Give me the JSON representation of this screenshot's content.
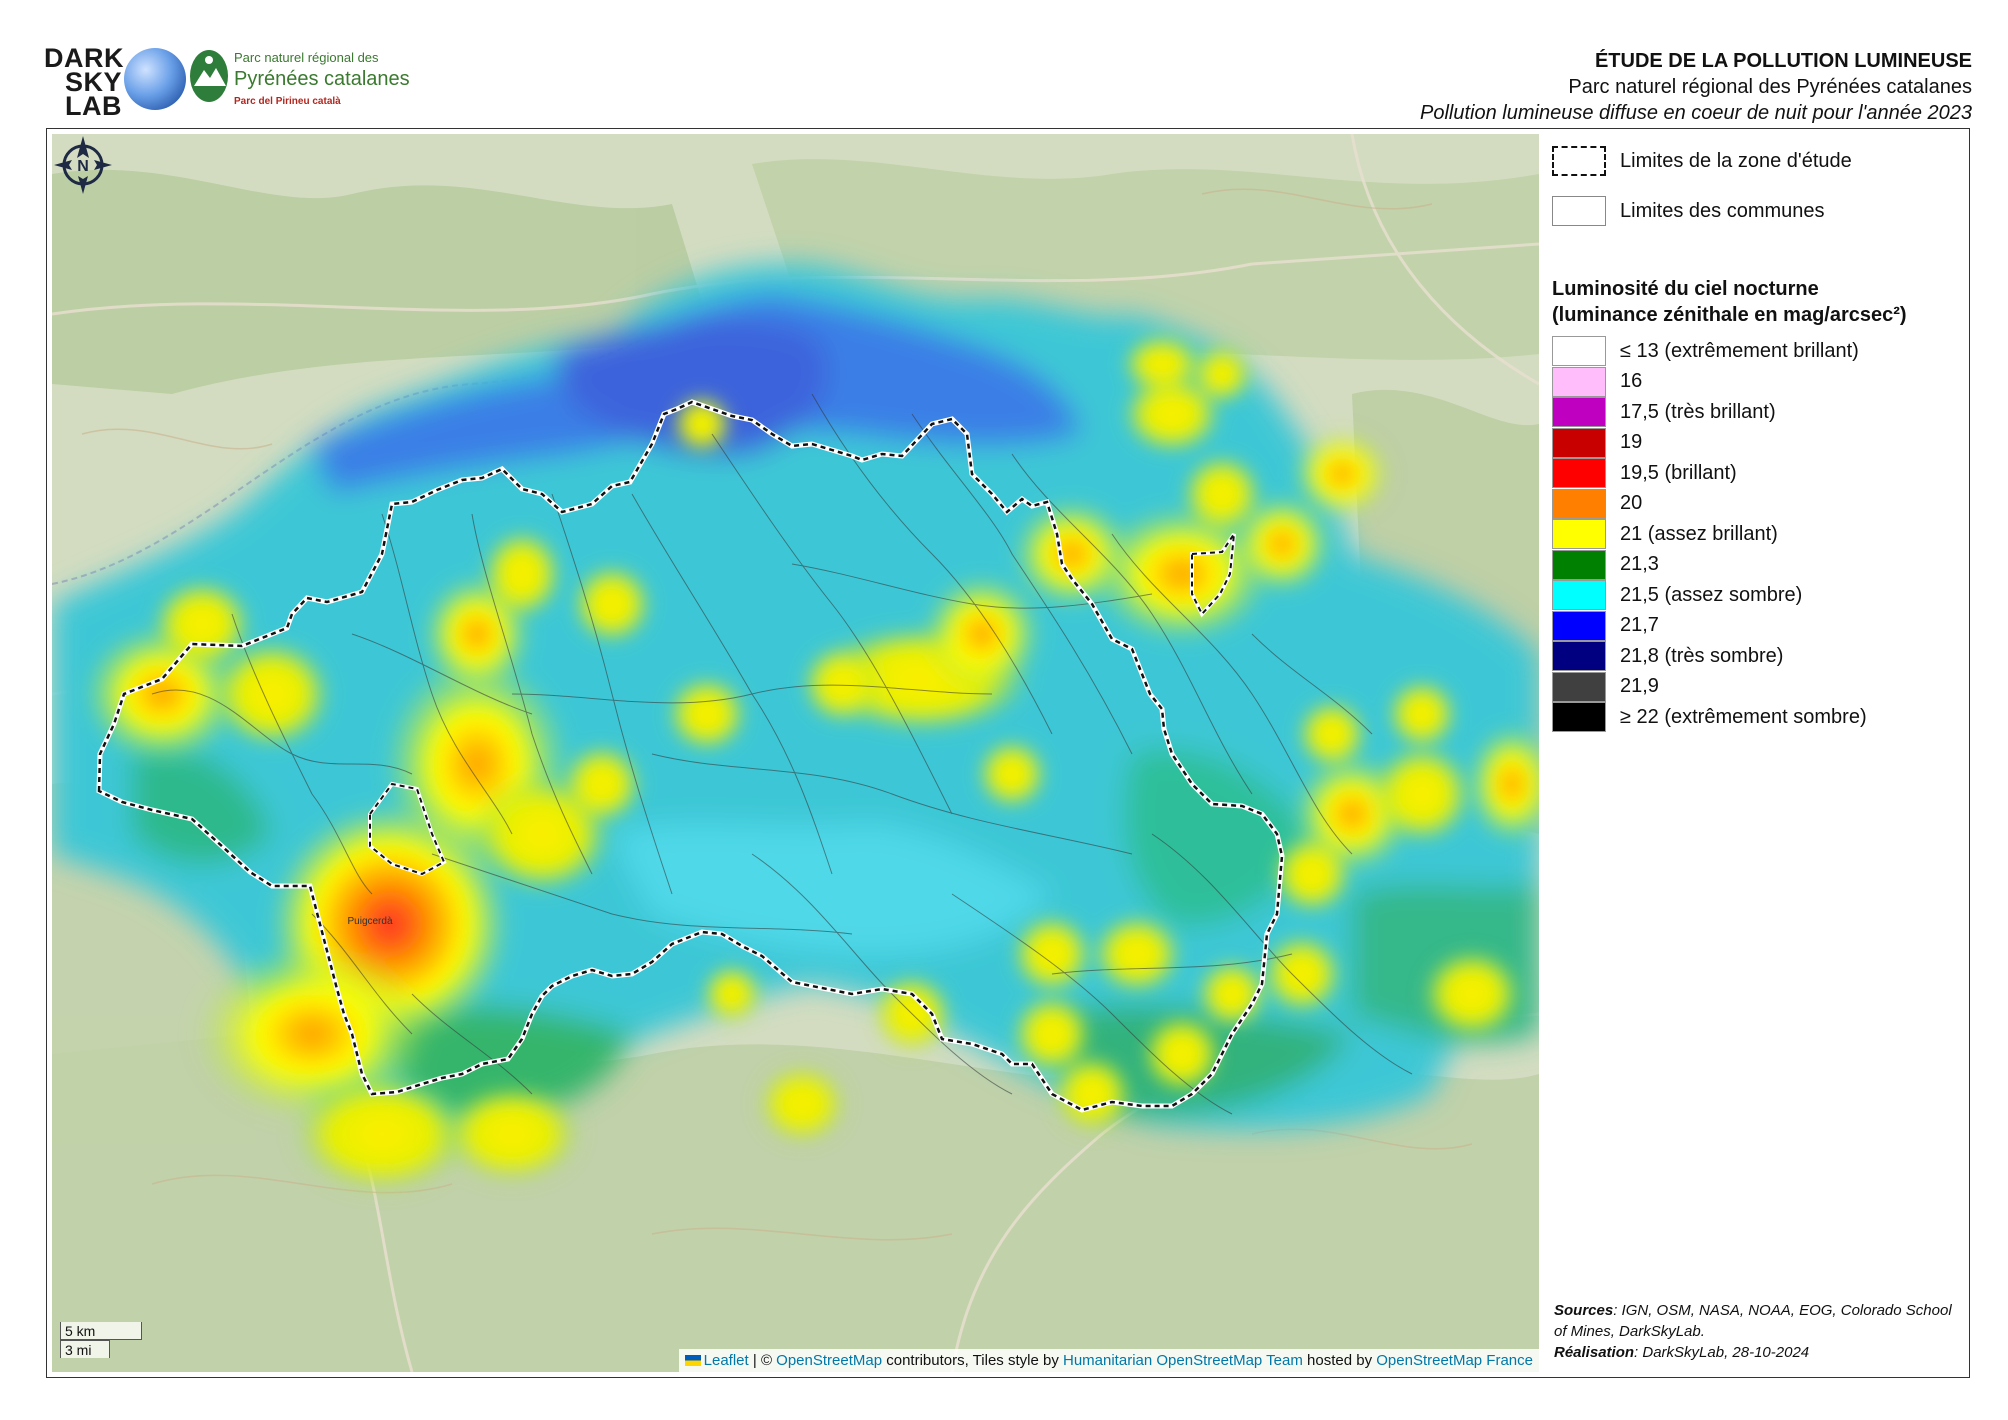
{
  "logos": {
    "darksky_lines": [
      "DARK",
      "SKY",
      "LAB"
    ],
    "park_line1": "Parc naturel régional des",
    "park_line2": "Pyrénées catalanes",
    "park_line3": "Parc del Pirineu català"
  },
  "header": {
    "title": "ÉTUDE DE LA POLLUTION LUMINEUSE",
    "subtitle": "Parc naturel régional des Pyrénées catalanes",
    "caption": "Pollution lumineuse diffuse en coeur de nuit pour l'année 2023"
  },
  "map": {
    "scale_km": "5 km",
    "scale_mi": "3 mi",
    "attribution": {
      "leaflet": "Leaflet",
      "osm": "OpenStreetMap",
      "contributors": "contributors, Tiles style by",
      "hot": "Humanitarian OpenStreetMap Team",
      "hosted": "hosted by",
      "osmfr": "OpenStreetMap France",
      "sep": "| ©"
    },
    "place_label": "Puigcerdà"
  },
  "legend": {
    "study_boundary": "Limites de la zone d'étude",
    "commune_boundary": "Limites des communes",
    "title_line1": "Luminosité du ciel nocturne",
    "title_line2": "(luminance zénithale en mag/arcsec²)",
    "classes": [
      {
        "label": "≤ 13 (extrêmement brillant)",
        "color": "#ffffff"
      },
      {
        "label": "16",
        "color": "#ffbdfb"
      },
      {
        "label": "17,5 (très brillant)",
        "color": "#c000c0"
      },
      {
        "label": "19",
        "color": "#c80000"
      },
      {
        "label": "19,5 (brillant)",
        "color": "#ff0000"
      },
      {
        "label": "20",
        "color": "#ff8000"
      },
      {
        "label": "21 (assez brillant)",
        "color": "#ffff00"
      },
      {
        "label": "21,3",
        "color": "#008000"
      },
      {
        "label": "21,5 (assez sombre)",
        "color": "#00ffff"
      },
      {
        "label": "21,7",
        "color": "#0000ff"
      },
      {
        "label": "21,8 (très sombre)",
        "color": "#000080"
      },
      {
        "label": "21,9",
        "color": "#404040"
      },
      {
        "label": "≥ 22 (extrêmement sombre)",
        "color": "#000000"
      }
    ]
  },
  "sources": {
    "sources_label": "Sources",
    "sources_text": ": IGN, OSM, NASA, NOAA, EOG, Colorado School of Mines, DarkSkyLab.",
    "realisation_label": "Réalisation",
    "realisation_text": ": DarkSkyLab, 28-10-2024"
  }
}
